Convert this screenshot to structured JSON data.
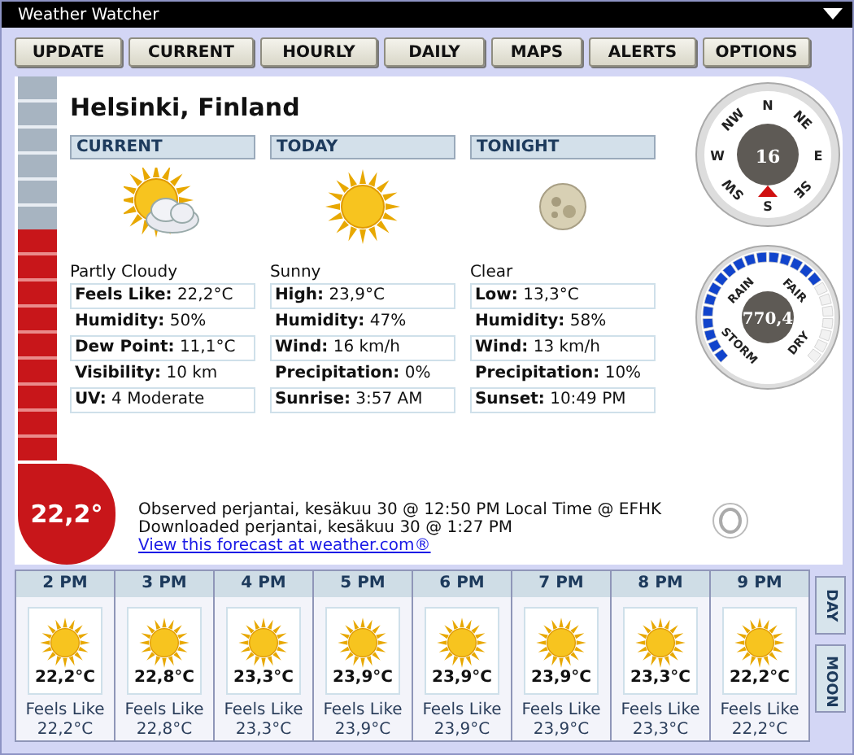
{
  "window": {
    "title": "Weather Watcher"
  },
  "toolbar": [
    {
      "label": "UPDATE"
    },
    {
      "label": "CURRENT"
    },
    {
      "label": "HOURLY"
    },
    {
      "label": "DAILY"
    },
    {
      "label": "MAPS"
    },
    {
      "label": "ALERTS"
    },
    {
      "label": "OPTIONS"
    }
  ],
  "location": "Helsinki, Finland",
  "thermometer": {
    "level": 0.6,
    "reading": "22,2°"
  },
  "panels": [
    {
      "heading": "CURRENT",
      "kind": "partly-cloudy",
      "condition": "Partly Cloudy",
      "rows": [
        {
          "label": "Feels Like:",
          "value": "22,2°C"
        },
        {
          "label": "Humidity:",
          "value": "50%"
        },
        {
          "label": "Dew Point:",
          "value": "11,1°C"
        },
        {
          "label": "Visibility:",
          "value": "10 km"
        },
        {
          "label": "UV:",
          "value": "4 Moderate"
        }
      ]
    },
    {
      "heading": "TODAY",
      "kind": "sunny",
      "condition": "Sunny",
      "rows": [
        {
          "label": "High:",
          "value": "23,9°C"
        },
        {
          "label": "Humidity:",
          "value": "47%"
        },
        {
          "label": "Wind:",
          "value": "16 km/h"
        },
        {
          "label": "Precipitation:",
          "value": "0%"
        },
        {
          "label": "Sunrise:",
          "value": "3:57 AM"
        }
      ]
    },
    {
      "heading": "TONIGHT",
      "kind": "moon",
      "condition": "Clear",
      "rows": [
        {
          "label": "Low:",
          "value": "13,3°C"
        },
        {
          "label": "Humidity:",
          "value": "58%"
        },
        {
          "label": "Wind:",
          "value": "13 km/h"
        },
        {
          "label": "Precipitation:",
          "value": "10%"
        },
        {
          "label": "Sunset:",
          "value": "10:49 PM"
        }
      ]
    }
  ],
  "compass": {
    "speed": "16",
    "points": [
      {
        "label": "N",
        "selected": false
      },
      {
        "label": "NE",
        "selected": false
      },
      {
        "label": "E",
        "selected": false
      },
      {
        "label": "SE",
        "selected": false
      },
      {
        "label": "S",
        "selected": true
      },
      {
        "label": "SW",
        "selected": false
      },
      {
        "label": "W",
        "selected": false
      },
      {
        "label": "NW",
        "selected": false
      }
    ]
  },
  "barometer": {
    "reading": "770,4",
    "level": 0.72,
    "labels": [
      "RAIN",
      "FAIR",
      "DRY",
      "STORM"
    ]
  },
  "observed": "Observed perjantai, kesäkuu 30 @ 12:50 PM Local Time @ EFHK",
  "downloaded": "Downloaded perjantai, kesäkuu 30 @ 1:27 PM",
  "link": "View this forecast at weather.com®",
  "hourly": [
    {
      "time": "2 PM",
      "kind": "sunny",
      "temp": "22,2°C",
      "feels_label": "Feels Like",
      "feels": "22,2°C"
    },
    {
      "time": "3 PM",
      "kind": "sunny",
      "temp": "22,8°C",
      "feels_label": "Feels Like",
      "feels": "22,8°C"
    },
    {
      "time": "4 PM",
      "kind": "sunny",
      "temp": "23,3°C",
      "feels_label": "Feels Like",
      "feels": "23,3°C"
    },
    {
      "time": "5 PM",
      "kind": "sunny",
      "temp": "23,9°C",
      "feels_label": "Feels Like",
      "feels": "23,9°C"
    },
    {
      "time": "6 PM",
      "kind": "sunny",
      "temp": "23,9°C",
      "feels_label": "Feels Like",
      "feels": "23,9°C"
    },
    {
      "time": "7 PM",
      "kind": "sunny",
      "temp": "23,9°C",
      "feels_label": "Feels Like",
      "feels": "23,9°C"
    },
    {
      "time": "8 PM",
      "kind": "sunny",
      "temp": "23,3°C",
      "feels_label": "Feels Like",
      "feels": "23,3°C"
    },
    {
      "time": "9 PM",
      "kind": "sunny",
      "temp": "22,2°C",
      "feels_label": "Feels Like",
      "feels": "22,2°C"
    }
  ],
  "side_tabs": [
    {
      "label": "DAY"
    },
    {
      "label": "MOON"
    }
  ]
}
